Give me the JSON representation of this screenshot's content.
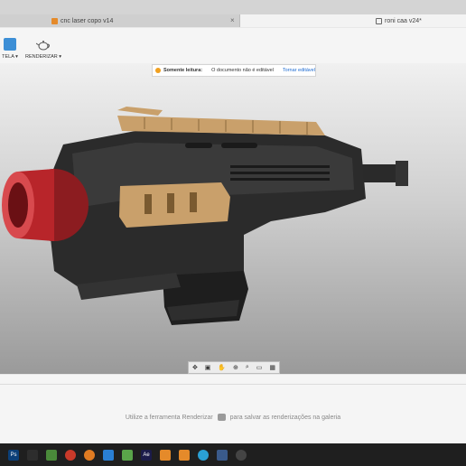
{
  "tabs": [
    {
      "label": "cnc laser copo v14",
      "close": "×"
    },
    {
      "label": "roni caa v24*"
    }
  ],
  "toolbar": {
    "tela_label": "TELA ▾",
    "render_label": "RENDERIZAR ▾"
  },
  "readonly": {
    "title": "Somente leitura:",
    "message": "O documento não é editável",
    "action": "Tornar editável"
  },
  "gallery": {
    "hint_before": "Utilize a ferramenta Renderizar",
    "hint_after": "para salvar as renderizações na galeria"
  },
  "taskbar": {
    "ps_label": "Ps",
    "ae_label": "Ae"
  },
  "colors": {
    "accent": "#1c6ad1",
    "model_body": "#2b2b2b",
    "model_tan": "#c9a06b",
    "model_red": "#b8252a"
  }
}
